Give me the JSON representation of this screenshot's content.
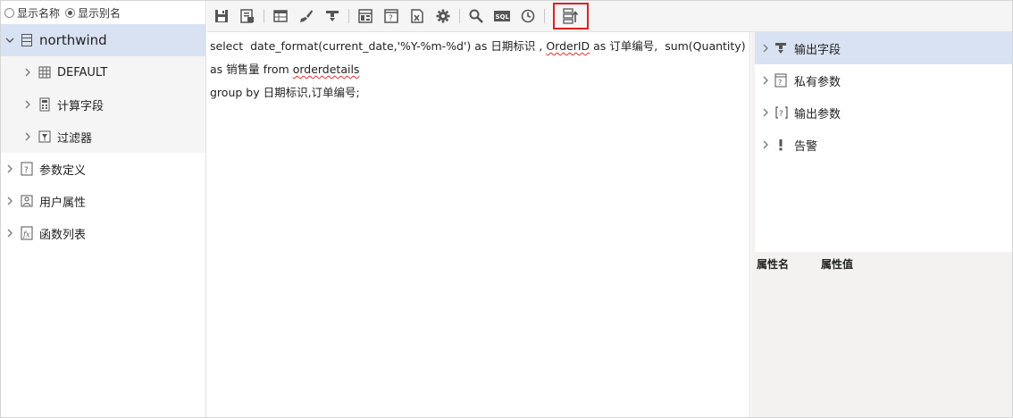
{
  "display_mode": {
    "options": [
      {
        "label": "显示名称",
        "selected": false
      },
      {
        "label": "显示别名",
        "selected": true
      }
    ]
  },
  "tree": {
    "root": {
      "label": "northwind",
      "expanded": true
    },
    "children": [
      {
        "label": "DEFAULT",
        "icon": "table-grid-icon"
      },
      {
        "label": "计算字段",
        "icon": "calculator-icon"
      },
      {
        "label": "过滤器",
        "icon": "filter-icon"
      }
    ],
    "siblings": [
      {
        "label": "参数定义",
        "icon": "param-define-icon"
      },
      {
        "label": "用户属性",
        "icon": "user-attr-icon"
      },
      {
        "label": "函数列表",
        "icon": "function-list-icon"
      }
    ]
  },
  "toolbar": {
    "buttons": [
      {
        "icon": "save-icon"
      },
      {
        "icon": "save-as-icon"
      },
      {
        "icon": "table-view-icon"
      },
      {
        "icon": "brush-icon"
      },
      {
        "icon": "output-field-icon"
      },
      {
        "icon": "layout-icon"
      },
      {
        "icon": "param-icon"
      },
      {
        "icon": "excel-icon"
      },
      {
        "icon": "gear-icon"
      },
      {
        "icon": "search-icon"
      },
      {
        "icon": "sql-icon",
        "text": "SQL"
      },
      {
        "icon": "clock-icon"
      },
      {
        "icon": "field-move-icon"
      }
    ]
  },
  "editor": {
    "line1_a": "select  date_format(current_date,'%Y-%m-%d') as 日期标识 , ",
    "line1_err": "OrderID",
    "line1_b": " as 订单编号,  sum(Quantity) as 销售量 from ",
    "line1_err2": "orderdetails",
    "line2": "group by 日期标识,订单编号;"
  },
  "right_tree": [
    {
      "label": "输出字段",
      "icon": "output-field-icon",
      "selected": true
    },
    {
      "label": "私有参数",
      "icon": "private-param-icon",
      "selected": false
    },
    {
      "label": "输出参数",
      "icon": "output-param-icon",
      "selected": false
    },
    {
      "label": "告警",
      "icon": "alert-icon",
      "selected": false
    }
  ],
  "properties": {
    "name_header": "属性名",
    "value_header": "属性值"
  }
}
